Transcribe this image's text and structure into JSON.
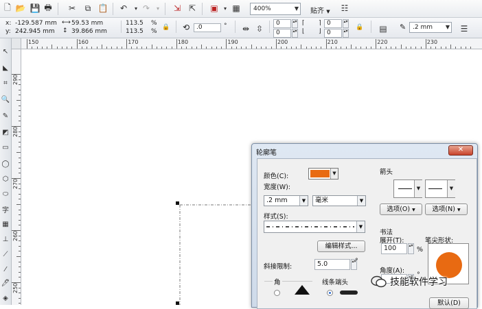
{
  "toolbar": {
    "zoom": "400%",
    "snap_label": "贴齐"
  },
  "property_bar": {
    "x_label": "x:",
    "x_value": "-129.587 mm",
    "y_label": "y:",
    "y_value": "242.945 mm",
    "width_value": "59.53 mm",
    "height_value": "39.866 mm",
    "scale_w": "113.5",
    "scale_h": "113.5",
    "percent": "%",
    "rotation": ".0",
    "degree": "°",
    "corner1": "0",
    "corner2": "0",
    "corner3": "0",
    "corner4": "0",
    "outline_width": ".2 mm"
  },
  "ruler": {
    "h_labels": [
      "150",
      "160",
      "170",
      "180",
      "190",
      "200",
      "210",
      "220",
      "230"
    ],
    "v_labels": [
      "290",
      "280",
      "270",
      "260",
      "250"
    ]
  },
  "dialog": {
    "title": "轮廓笔",
    "close": "✕",
    "color_label": "颜色(C):",
    "color_value": "#e86a12",
    "width_label": "宽度(W):",
    "width_value": ".2 mm",
    "unit_value": "毫米",
    "style_label": "样式(S):",
    "edit_style_button": "编辑样式...",
    "miter_label": "斜接限制:",
    "miter_value": "5.0",
    "corner_label": "角",
    "linecap_label": "线条端头",
    "arrows_label": "箭头",
    "options_left": "选项(O)",
    "options_right": "选项(N)",
    "calligraphy_label": "书法",
    "stretch_label": "展开(T):",
    "stretch_value": "100",
    "percent": "%",
    "nib_label": "笔尖形状:",
    "angle_label": "角度(A):",
    "default_button": "默认(D)",
    "nib_color": "#e86a12"
  },
  "watermark": {
    "text": "技能软件学习"
  }
}
